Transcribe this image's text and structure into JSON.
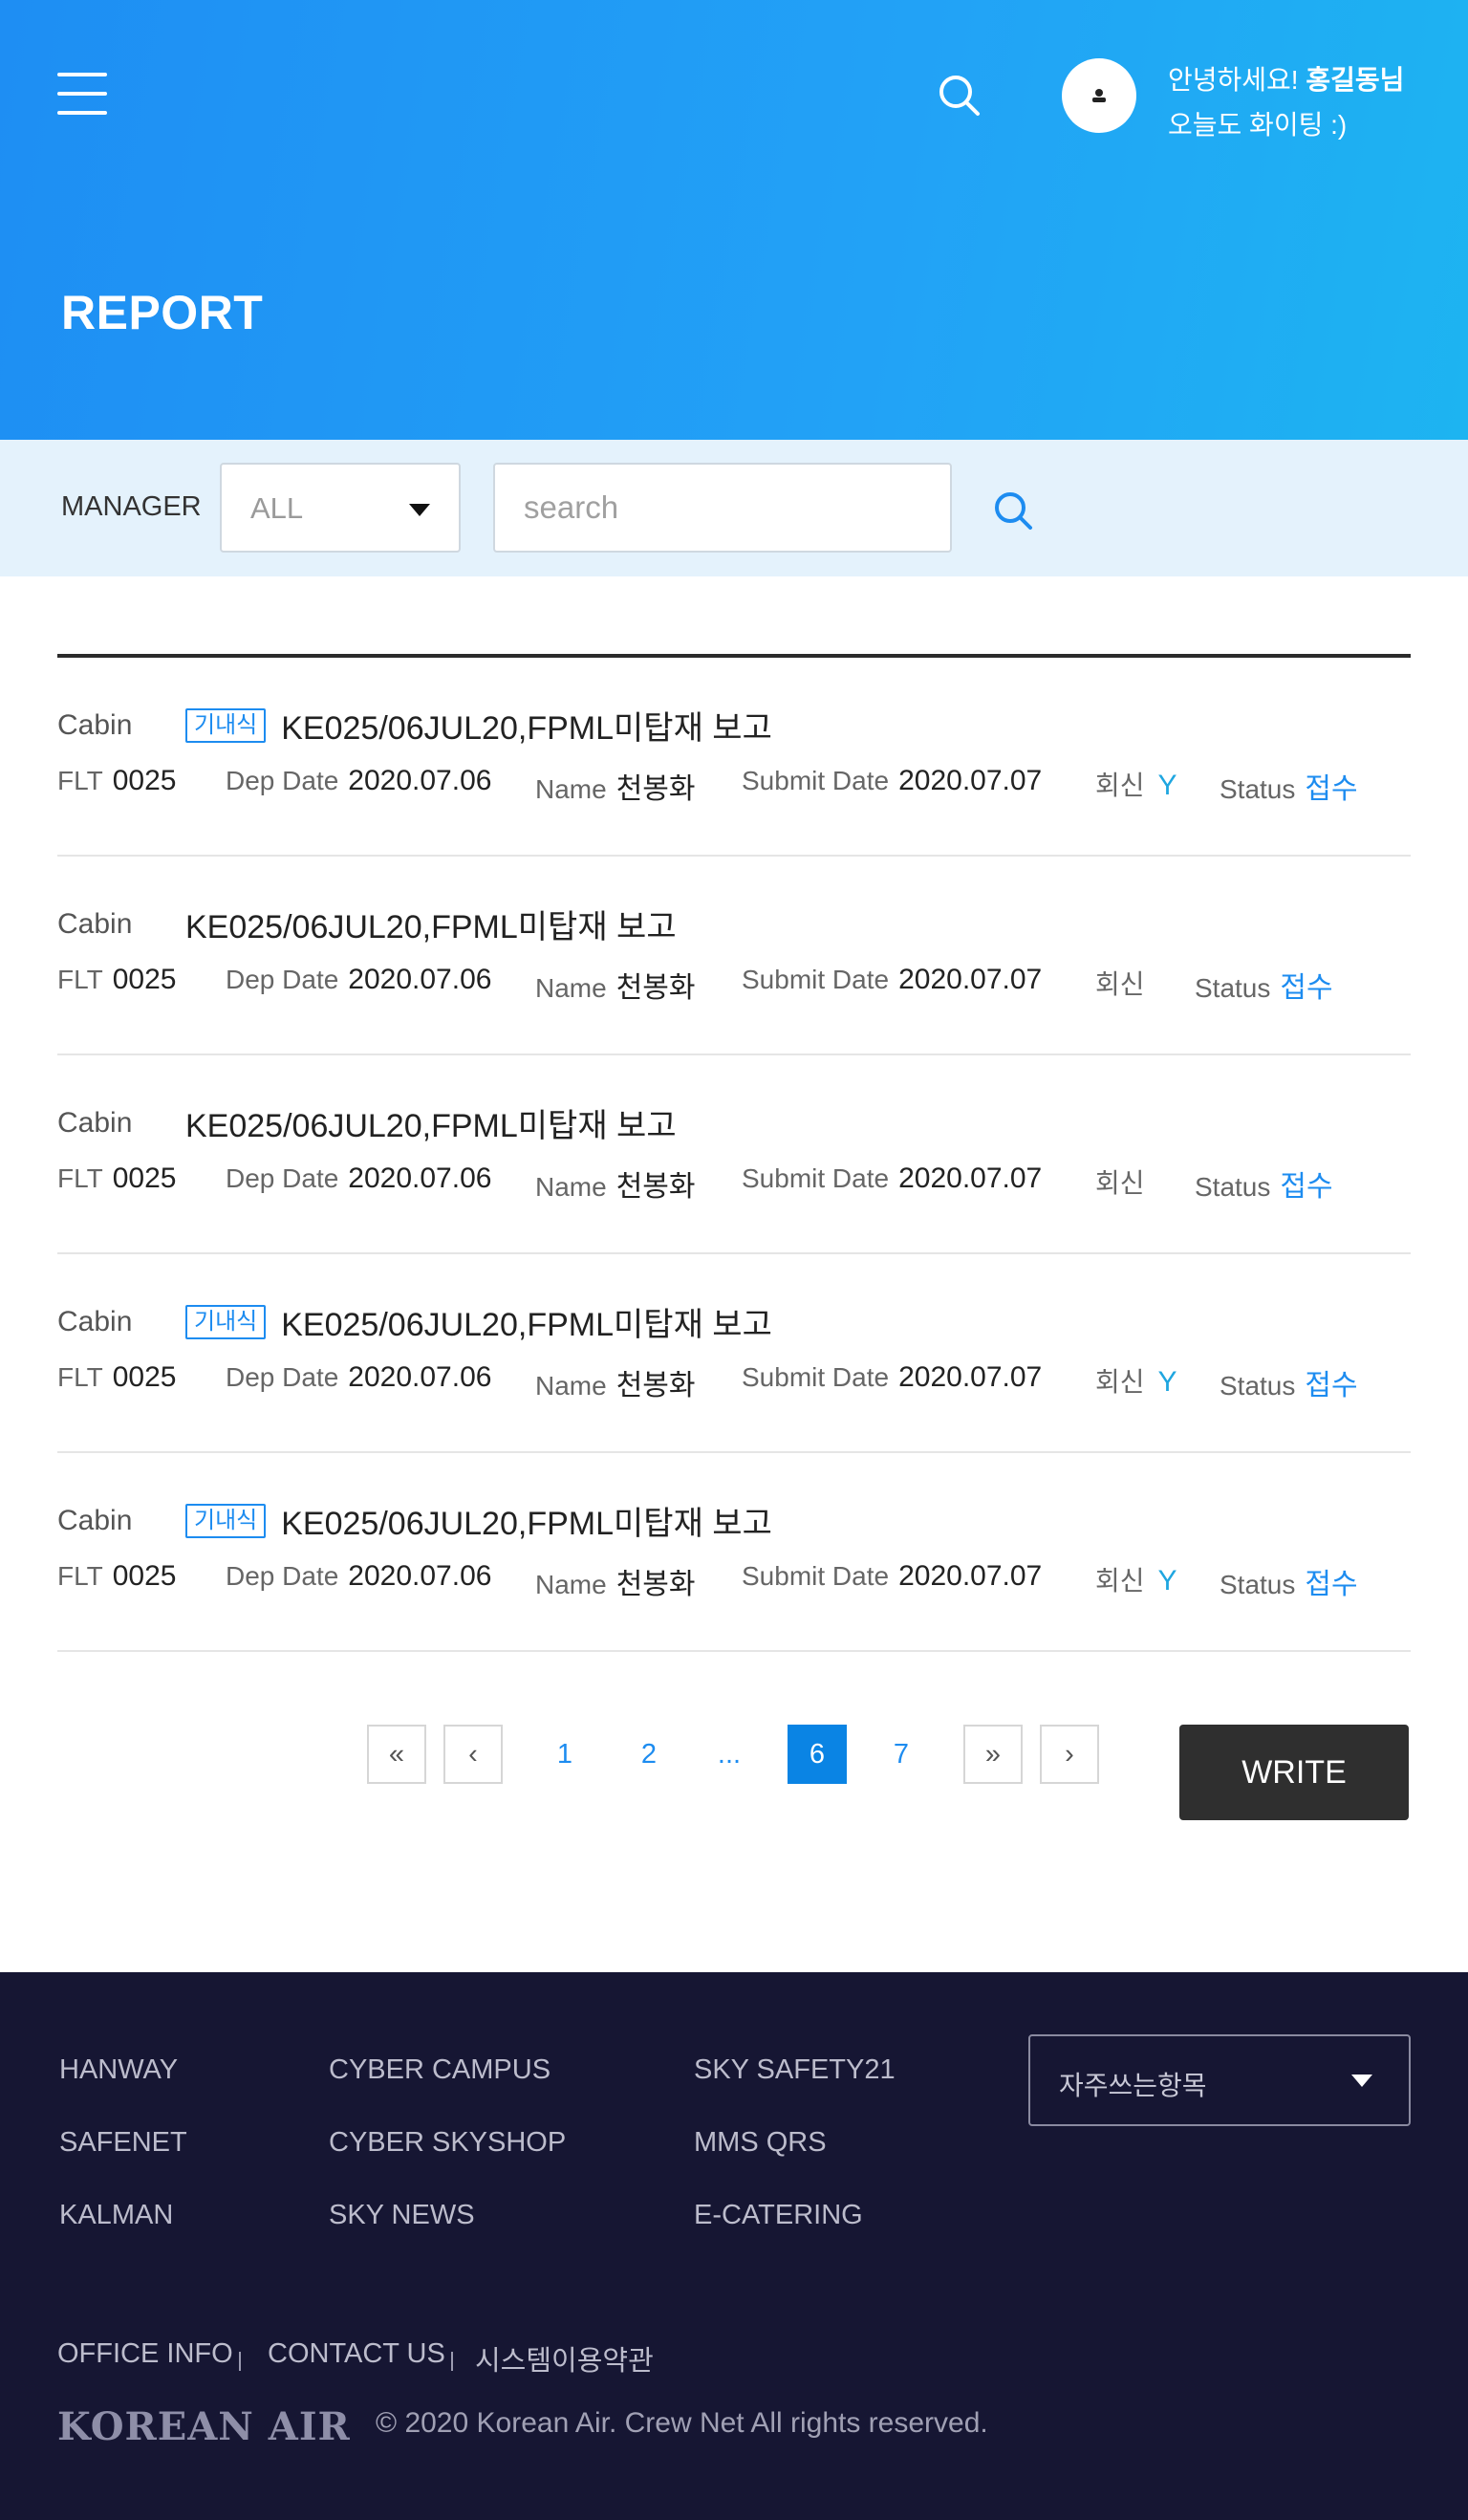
{
  "header": {
    "greeting_prefix": "안녕하세요! ",
    "user_name": "홍길동님",
    "greeting_line2": "오늘도 화이팅 :)",
    "page_title": "REPORT"
  },
  "filter": {
    "label": "MANAGER",
    "select_value": "ALL",
    "search_placeholder": "search"
  },
  "labels": {
    "flt": "FLT",
    "dep_date": "Dep Date",
    "name": "Name",
    "submit_date": "Submit Date",
    "reply": "회신",
    "status": "Status"
  },
  "reports": [
    {
      "category": "Cabin",
      "tag": "기내식",
      "title": "KE025/06JUL20,FPML미탑재 보고",
      "flt": "0025",
      "dep_date": "2020.07.06",
      "name": "천봉화",
      "submit_date": "2020.07.07",
      "reply": "Y",
      "status": "접수"
    },
    {
      "category": "Cabin",
      "tag": "",
      "title": "KE025/06JUL20,FPML미탑재 보고",
      "flt": "0025",
      "dep_date": "2020.07.06",
      "name": "천봉화",
      "submit_date": "2020.07.07",
      "reply": "",
      "status": "접수"
    },
    {
      "category": "Cabin",
      "tag": "",
      "title": "KE025/06JUL20,FPML미탑재 보고",
      "flt": "0025",
      "dep_date": "2020.07.06",
      "name": "천봉화",
      "submit_date": "2020.07.07",
      "reply": "",
      "status": "접수"
    },
    {
      "category": "Cabin",
      "tag": "기내식",
      "title": "KE025/06JUL20,FPML미탑재 보고",
      "flt": "0025",
      "dep_date": "2020.07.06",
      "name": "천봉화",
      "submit_date": "2020.07.07",
      "reply": "Y",
      "status": "접수"
    },
    {
      "category": "Cabin",
      "tag": "기내식",
      "title": "KE025/06JUL20,FPML미탑재 보고",
      "flt": "0025",
      "dep_date": "2020.07.06",
      "name": "천봉화",
      "submit_date": "2020.07.07",
      "reply": "Y",
      "status": "접수"
    }
  ],
  "pagination": {
    "first": "«",
    "prev": "‹",
    "pages": [
      "1",
      "2",
      "...",
      "6",
      "7"
    ],
    "current": "6",
    "last": "»",
    "next": "›"
  },
  "write_label": "WRITE",
  "footer": {
    "col1": [
      "HANWAY",
      "SAFENET",
      "KALMAN"
    ],
    "col2": [
      "CYBER CAMPUS",
      "CYBER SKYSHOP",
      "SKY NEWS"
    ],
    "col3": [
      "SKY SAFETY21",
      "MMS QRS",
      "E-CATERING"
    ],
    "quick_select": "자주쓰는항목",
    "bottom_links": [
      "OFFICE INFO",
      "CONTACT US",
      "시스템이용약관"
    ],
    "logo_text": "KOREAN AIR",
    "copyright": "© 2020 Korean Air. Crew Net  All rights reserved."
  },
  "colors": {
    "header_gradient_start": "#1e8ef3",
    "header_gradient_end": "#1db4f1",
    "accent": "#1d8cf0",
    "footer_bg": "#161633",
    "write_button": "#2f2f2f"
  },
  "icons": [
    "hamburger-menu-icon",
    "search-icon",
    "user-icon",
    "chevron-down-icon"
  ]
}
